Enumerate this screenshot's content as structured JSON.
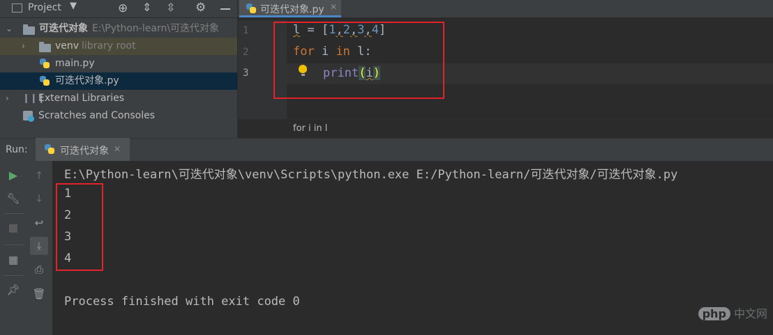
{
  "project": {
    "title": "Project",
    "root": {
      "name": "可迭代对象",
      "path": "E:\\Python-learn\\可迭代对象"
    },
    "items": [
      {
        "name": "venv",
        "note": "library root"
      },
      {
        "name": "main.py"
      },
      {
        "name": "可迭代对象.py"
      }
    ],
    "external": "External Libraries",
    "scratches": "Scratches and Consoles"
  },
  "editor": {
    "tab": "可迭代对象.py",
    "line_numbers": [
      "1",
      "2",
      "3"
    ],
    "code": {
      "l1_var": "l",
      "l1_eq": " = [",
      "n1": "1",
      "n2": "2",
      "n3": "3",
      "n4": "4",
      "comma": ",",
      "close": "]",
      "l2_for": "for",
      "l2_i": " i ",
      "l2_in": "in",
      "l2_rest": " l:",
      "l3_print": "print",
      "l3_open": "(",
      "l3_arg": "i",
      "l3_close": ")"
    },
    "breadcrumb": "for i in l"
  },
  "run": {
    "label": "Run:",
    "tab": "可迭代对象",
    "command": "E:\\Python-learn\\可迭代对象\\venv\\Scripts\\python.exe E:/Python-learn/可迭代对象/可迭代对象.py",
    "outputs": [
      "1",
      "2",
      "3",
      "4"
    ],
    "finish": "Process finished with exit code 0"
  },
  "watermark": {
    "badge": "php",
    "text": "中文网"
  },
  "colors": {
    "accent": "#4a88c7",
    "highlight_box": "#e5212a",
    "keyword": "#cc7832",
    "number": "#6897bb"
  }
}
